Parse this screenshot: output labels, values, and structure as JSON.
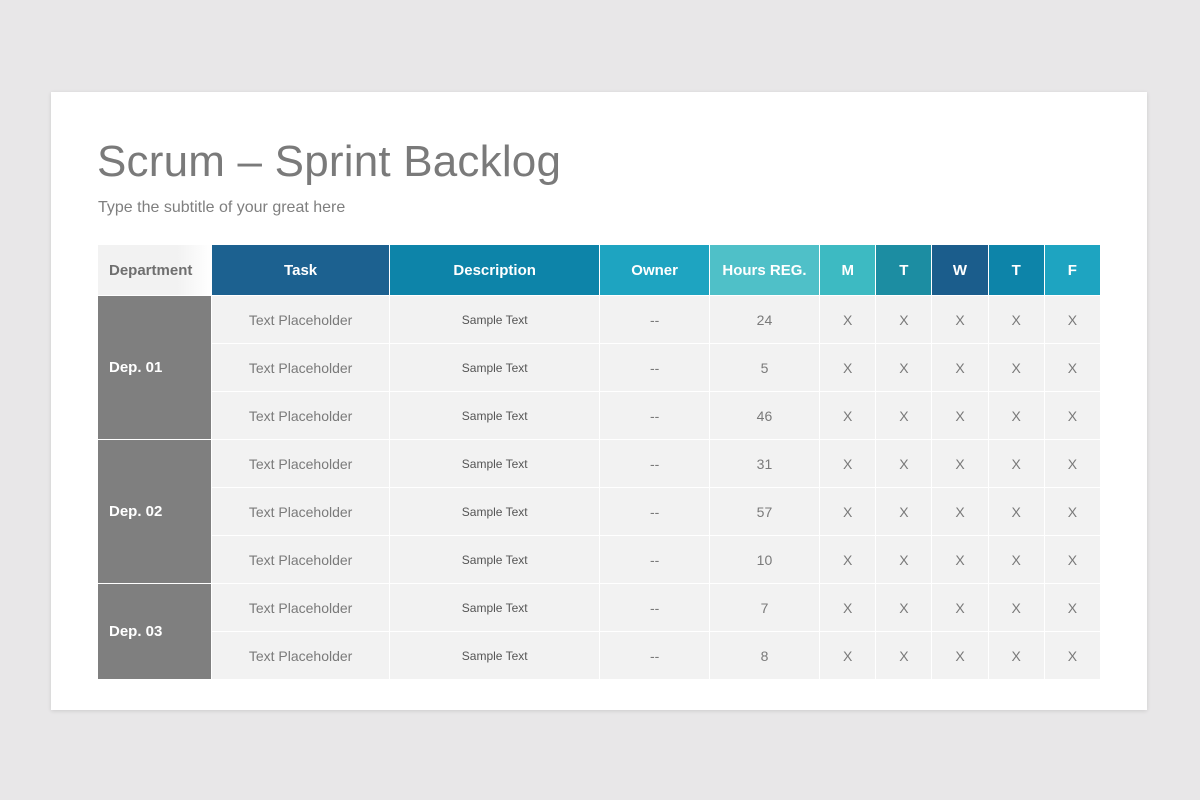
{
  "title": "Scrum – Sprint Backlog",
  "subtitle": "Type the subtitle of your great here",
  "colors": {
    "background": "#e8e7e8",
    "slide": "#ffffff",
    "department_cell": "#7f7f7f",
    "row_cell": "#f2f2f2"
  },
  "table": {
    "headers": [
      {
        "label": "Department",
        "color": "#f2f2f2"
      },
      {
        "label": "Task",
        "color": "#1c6190"
      },
      {
        "label": "Description",
        "color": "#0d84a9"
      },
      {
        "label": "Owner",
        "color": "#1ea4c1"
      },
      {
        "label": "Hours REG.",
        "color": "#4fc0c8"
      },
      {
        "label": "M",
        "color": "#3dbac2"
      },
      {
        "label": "T",
        "color": "#1c8da2"
      },
      {
        "label": "W",
        "color": "#1b5d8c"
      },
      {
        "label": "T",
        "color": "#0d84a9"
      },
      {
        "label": "F",
        "color": "#1ea4c1"
      }
    ],
    "departments": [
      {
        "name": "Dep. 01",
        "rows": [
          {
            "task": "Text Placeholder",
            "description": "Sample Text",
            "owner": "--",
            "hours": "24",
            "m": "X",
            "t1": "X",
            "w": "X",
            "t2": "X",
            "f": "X"
          },
          {
            "task": "Text Placeholder",
            "description": "Sample Text",
            "owner": "--",
            "hours": "5",
            "m": "X",
            "t1": "X",
            "w": "X",
            "t2": "X",
            "f": "X"
          },
          {
            "task": "Text Placeholder",
            "description": "Sample Text",
            "owner": "--",
            "hours": "46",
            "m": "X",
            "t1": "X",
            "w": "X",
            "t2": "X",
            "f": "X"
          }
        ]
      },
      {
        "name": "Dep. 02",
        "rows": [
          {
            "task": "Text Placeholder",
            "description": "Sample Text",
            "owner": "--",
            "hours": "31",
            "m": "X",
            "t1": "X",
            "w": "X",
            "t2": "X",
            "f": "X"
          },
          {
            "task": "Text Placeholder",
            "description": "Sample Text",
            "owner": "--",
            "hours": "57",
            "m": "X",
            "t1": "X",
            "w": "X",
            "t2": "X",
            "f": "X"
          },
          {
            "task": "Text Placeholder",
            "description": "Sample Text",
            "owner": "--",
            "hours": "10",
            "m": "X",
            "t1": "X",
            "w": "X",
            "t2": "X",
            "f": "X"
          }
        ]
      },
      {
        "name": "Dep. 03",
        "rows": [
          {
            "task": "Text Placeholder",
            "description": "Sample Text",
            "owner": "--",
            "hours": "7",
            "m": "X",
            "t1": "X",
            "w": "X",
            "t2": "X",
            "f": "X"
          },
          {
            "task": "Text Placeholder",
            "description": "Sample Text",
            "owner": "--",
            "hours": "8",
            "m": "X",
            "t1": "X",
            "w": "X",
            "t2": "X",
            "f": "X"
          }
        ]
      }
    ]
  }
}
